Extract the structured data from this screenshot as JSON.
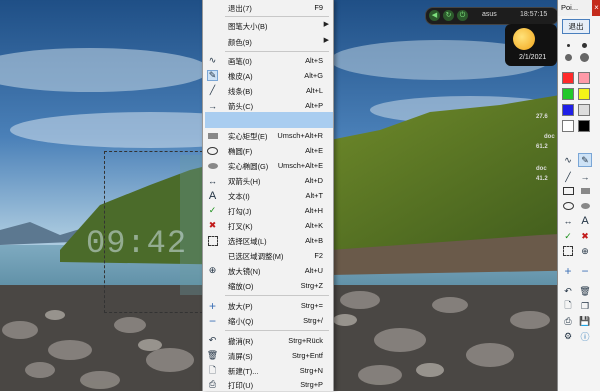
{
  "desktop": {
    "clock_overlay": "09:42"
  },
  "context_menu": {
    "items": [
      {
        "label": "退出(7)",
        "shortcut": "F9",
        "icon": ""
      },
      {
        "label": "图笔大小(B)",
        "shortcut": "",
        "icon": "",
        "submenu": true
      },
      {
        "label": "颜色(9)",
        "shortcut": "",
        "icon": "",
        "submenu": true
      },
      {
        "label": "画笔(0)",
        "shortcut": "Alt+S",
        "icon": "pen-icon"
      },
      {
        "label": "橡皮(A)",
        "shortcut": "Alt+G",
        "icon": "eraser-icon"
      },
      {
        "label": "线条(B)",
        "shortcut": "Alt+L",
        "icon": "line-icon"
      },
      {
        "label": "箭头(C)",
        "shortcut": "Alt+P",
        "icon": "arrow-icon"
      },
      {
        "label": "实心矩型(E)",
        "shortcut": "Umsch+Alt+R",
        "icon": "filled-rect-icon"
      },
      {
        "label": "椭圆(F)",
        "shortcut": "Alt+E",
        "icon": "ellipse-icon"
      },
      {
        "label": "实心椭圆(G)",
        "shortcut": "Umsch+Alt+E",
        "icon": "filled-ellipse-icon"
      },
      {
        "label": "双箭头(H)",
        "shortcut": "Alt+D",
        "icon": "double-arrow-icon"
      },
      {
        "label": "文本(I)",
        "shortcut": "Alt+T",
        "icon": "text-icon"
      },
      {
        "label": "打勾(J)",
        "shortcut": "Alt+H",
        "icon": "checkmark-icon"
      },
      {
        "label": "打叉(K)",
        "shortcut": "Alt+K",
        "icon": "cross-icon"
      },
      {
        "label": "选择区域(L)",
        "shortcut": "Alt+B",
        "icon": "select-area-icon"
      },
      {
        "label": "已选区域调整(M)",
        "shortcut": "F2",
        "icon": ""
      },
      {
        "label": "放大镜(N)",
        "shortcut": "Alt+U",
        "icon": "magnifier-icon"
      },
      {
        "label": "缩放(O)",
        "shortcut": "Strg+Z",
        "icon": ""
      },
      {
        "label": "放大(P)",
        "shortcut": "Strg+=",
        "icon": "zoom-in-icon"
      },
      {
        "label": "缩小(Q)",
        "shortcut": "Strg+/",
        "icon": "zoom-out-icon"
      },
      {
        "label": "撤消(R)",
        "shortcut": "Strg+Rück",
        "icon": "undo-icon"
      },
      {
        "label": "清屏(S)",
        "shortcut": "Strg+Entf",
        "icon": "trash-icon"
      },
      {
        "label": "新建(T)...",
        "shortcut": "Strg+N",
        "icon": "new-file-icon"
      },
      {
        "label": "打印(U)",
        "shortcut": "Strg+P",
        "icon": "print-icon"
      }
    ]
  },
  "statusbar": {
    "host": "asus",
    "time": "18:57:15"
  },
  "weather": {
    "date": "2/1/2021"
  },
  "gauge_widget": {
    "v1": "27.6",
    "l1": "doc",
    "v2": "61.2",
    "l2": "doc",
    "v3": "41.2"
  },
  "pointofix": {
    "title": "Poi...",
    "exit_label": "退出",
    "text_tool": "A",
    "colors": [
      "#ff2a2a",
      "#ff9aa8",
      "#22c82a",
      "#f4f418",
      "#1f1fe6",
      "#dcdcdc",
      "#ffffff",
      "#000000"
    ]
  }
}
